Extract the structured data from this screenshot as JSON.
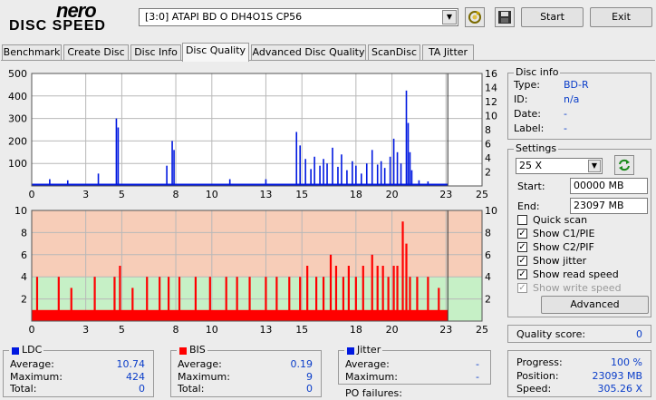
{
  "app": {
    "logo_top": "nero",
    "logo_bottom": "DISC SPEED"
  },
  "drive_select": {
    "value": "[3:0]  ATAPI BD  O  DH4O1S CP56"
  },
  "buttons": {
    "start": "Start",
    "exit": "Exit",
    "advanced": "Advanced"
  },
  "icons": {
    "refresh": "refresh-icon",
    "save": "save-icon",
    "dropdown": "chevron-down-icon"
  },
  "tabs": [
    "Benchmark",
    "Create Disc",
    "Disc Info",
    "Disc Quality",
    "Advanced Disc Quality",
    "ScanDisc",
    "TA Jitter"
  ],
  "active_tab": "Disc Quality",
  "disc_info": {
    "title": "Disc info",
    "type_label": "Type:",
    "type_value": "BD-R",
    "id_label": "ID:",
    "id_value": "n/a",
    "date_label": "Date:",
    "date_value": "-",
    "label_label": "Label:",
    "label_value": "-"
  },
  "settings": {
    "title": "Settings",
    "speed": "25 X",
    "start_label": "Start:",
    "start_value": "00000 MB",
    "end_label": "End:",
    "end_value": "23097 MB",
    "checks": [
      {
        "label": "Quick scan",
        "checked": false,
        "disabled": false
      },
      {
        "label": "Show C1/PIE",
        "checked": true,
        "disabled": false
      },
      {
        "label": "Show C2/PIF",
        "checked": true,
        "disabled": false
      },
      {
        "label": "Show jitter",
        "checked": true,
        "disabled": false
      },
      {
        "label": "Show read speed",
        "checked": true,
        "disabled": false
      },
      {
        "label": "Show write speed",
        "checked": true,
        "disabled": true
      }
    ]
  },
  "quality": {
    "label": "Quality score:",
    "value": "0"
  },
  "progress": {
    "progress_label": "Progress:",
    "progress_value": "100 %",
    "position_label": "Position:",
    "position_value": "23093 MB",
    "speed_label": "Speed:",
    "speed_value": "305.26 X"
  },
  "ldc": {
    "title": "LDC",
    "avg_label": "Average:",
    "avg": "10.74",
    "max_label": "Maximum:",
    "max": "424",
    "total_label": "Total:",
    "total": "0"
  },
  "bis": {
    "title": "BIS",
    "avg_label": "Average:",
    "avg": "0.19",
    "max_label": "Maximum:",
    "max": "9",
    "total_label": "Total:",
    "total": "0"
  },
  "jitter": {
    "title": "Jitter",
    "avg_label": "Average:",
    "avg": "-",
    "max_label": "Maximum:",
    "max": "-",
    "po_label": "PO failures:"
  },
  "colors": {
    "ldc": "#0018e0",
    "bis": "#ff0000",
    "jitter": "#0018e0",
    "good_zone": "#c6f0c6",
    "warn_zone": "#f7cdb8"
  },
  "chart_data": [
    {
      "type": "area",
      "name": "LDC",
      "x_ticks": [
        0,
        3,
        5,
        8,
        10,
        13,
        15,
        18,
        20,
        23,
        25
      ],
      "y_left_ticks": [
        100,
        200,
        300,
        400,
        500
      ],
      "y_right_ticks": [
        2,
        4,
        6,
        8,
        10,
        12,
        14,
        16
      ],
      "xlim": [
        0,
        25
      ],
      "ylim": [
        0,
        500
      ],
      "x_end": 23.1,
      "baseline": 10,
      "spikes": [
        [
          1.0,
          30
        ],
        [
          2.0,
          25
        ],
        [
          3.7,
          55
        ],
        [
          4.7,
          300
        ],
        [
          4.8,
          260
        ],
        [
          7.5,
          90
        ],
        [
          7.8,
          200
        ],
        [
          7.9,
          160
        ],
        [
          11.0,
          30
        ],
        [
          13.0,
          30
        ],
        [
          14.7,
          240
        ],
        [
          14.9,
          180
        ],
        [
          15.2,
          120
        ],
        [
          15.5,
          75
        ],
        [
          15.7,
          130
        ],
        [
          16.0,
          90
        ],
        [
          16.2,
          120
        ],
        [
          16.4,
          100
        ],
        [
          16.7,
          170
        ],
        [
          17.0,
          85
        ],
        [
          17.2,
          140
        ],
        [
          17.5,
          70
        ],
        [
          17.8,
          110
        ],
        [
          18.0,
          90
        ],
        [
          18.3,
          55
        ],
        [
          18.6,
          100
        ],
        [
          18.9,
          160
        ],
        [
          19.2,
          95
        ],
        [
          19.4,
          110
        ],
        [
          19.6,
          80
        ],
        [
          19.9,
          130
        ],
        [
          20.1,
          210
        ],
        [
          20.3,
          150
        ],
        [
          20.5,
          100
        ],
        [
          20.8,
          424
        ],
        [
          20.9,
          280
        ],
        [
          21.0,
          150
        ],
        [
          21.1,
          70
        ],
        [
          21.5,
          25
        ],
        [
          22.0,
          20
        ]
      ]
    },
    {
      "type": "bar",
      "name": "BIS",
      "x_ticks": [
        0,
        3,
        5,
        8,
        10,
        13,
        15,
        18,
        20,
        23,
        25
      ],
      "y_left_ticks": [
        2,
        4,
        6,
        8,
        10
      ],
      "y_right_ticks": [
        2,
        4,
        6,
        8,
        10
      ],
      "xlim": [
        0,
        25
      ],
      "ylim": [
        0,
        10
      ],
      "x_end": 23.1,
      "baseline": 1,
      "good_threshold": 4,
      "spikes": [
        [
          0.3,
          4
        ],
        [
          1.5,
          4
        ],
        [
          2.2,
          3
        ],
        [
          3.5,
          4
        ],
        [
          4.6,
          4
        ],
        [
          4.9,
          5
        ],
        [
          5.6,
          3
        ],
        [
          6.4,
          4
        ],
        [
          7.1,
          4
        ],
        [
          7.6,
          4
        ],
        [
          8.2,
          4
        ],
        [
          9.1,
          4
        ],
        [
          9.9,
          4
        ],
        [
          10.8,
          4
        ],
        [
          11.4,
          4
        ],
        [
          12.1,
          4
        ],
        [
          13.0,
          4
        ],
        [
          13.6,
          4
        ],
        [
          14.3,
          4
        ],
        [
          14.9,
          4
        ],
        [
          15.3,
          5
        ],
        [
          15.8,
          4
        ],
        [
          16.2,
          4
        ],
        [
          16.6,
          6
        ],
        [
          16.9,
          5
        ],
        [
          17.3,
          4
        ],
        [
          17.6,
          5
        ],
        [
          18.0,
          4
        ],
        [
          18.4,
          5
        ],
        [
          18.9,
          6
        ],
        [
          19.2,
          5
        ],
        [
          19.5,
          5
        ],
        [
          19.8,
          4
        ],
        [
          20.1,
          5
        ],
        [
          20.3,
          5
        ],
        [
          20.6,
          9
        ],
        [
          20.8,
          7
        ],
        [
          21.0,
          4
        ],
        [
          21.4,
          4
        ],
        [
          22.0,
          4
        ],
        [
          22.6,
          3
        ]
      ]
    }
  ]
}
